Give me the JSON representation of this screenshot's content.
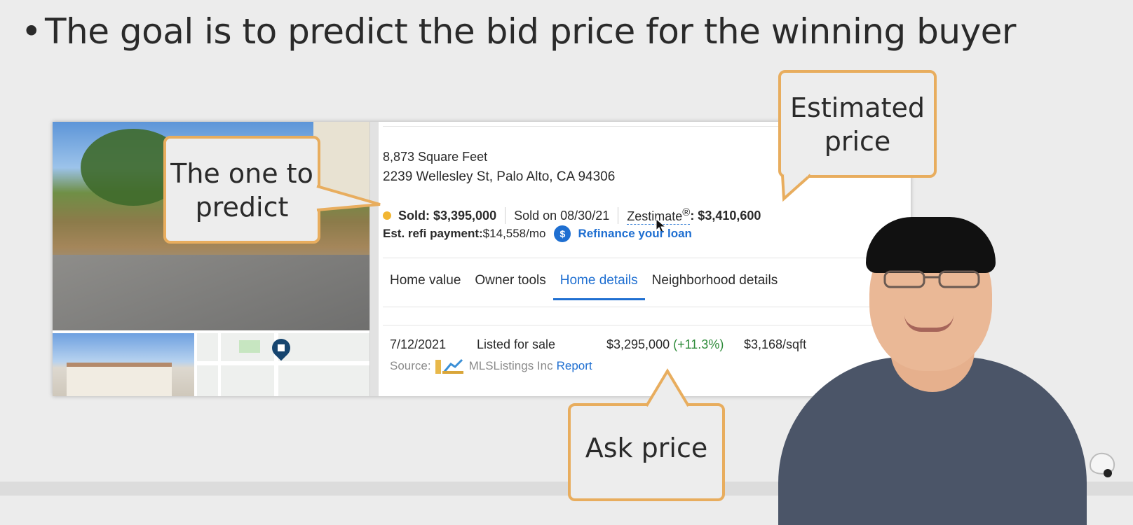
{
  "slide": {
    "bullet": "•",
    "title": "The goal is to predict the bid price for the winning buyer"
  },
  "listing": {
    "square_feet": "8,873 Square Feet",
    "address": "2239 Wellesley St, Palo Alto, CA 94306",
    "sold_label": "Sold: $3,395,000",
    "sold_on": "Sold on 08/30/21",
    "zestimate_label": "Zestimate",
    "zestimate_mark": "®",
    "zestimate_value": ": $3,410,600",
    "refi_label": "Est. refi payment:",
    "refi_value": " $14,558/mo",
    "refi_icon_glyph": "$",
    "refi_link": "Refinance your loan",
    "tabs": [
      "Home value",
      "Owner tools",
      "Home details",
      "Neighborhood details"
    ],
    "active_tab": "Home details",
    "history": {
      "date": "7/12/2021",
      "event": "Listed for sale",
      "price": "$3,295,000",
      "change": "(+11.3%)",
      "per_sqft": "$3,168/sqft",
      "source_label": "Source:",
      "source_name": "MLSListings Inc",
      "report_link": "Report"
    }
  },
  "callouts": {
    "predict_line1": "The one to",
    "predict_line2": "predict",
    "estimated_line1": "Estimated",
    "estimated_line2": "price",
    "ask": "Ask price"
  },
  "colors": {
    "callout_border": "#e8ad5e",
    "link_blue": "#1f6fd1",
    "sold_dot": "#f2b632",
    "positive_green": "#2e8b3a"
  }
}
